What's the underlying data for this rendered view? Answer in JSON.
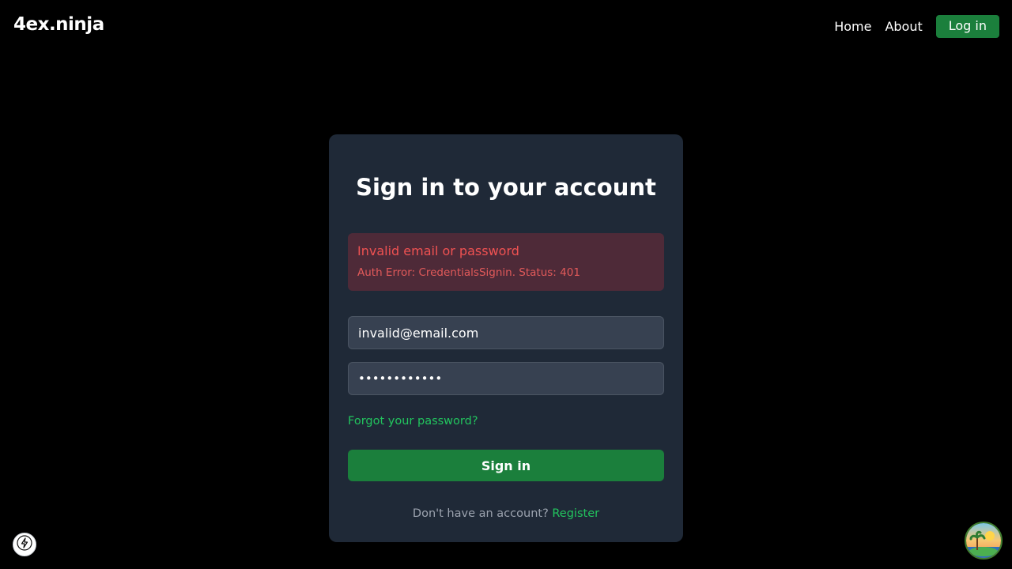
{
  "navbar": {
    "brand": "4ex.ninja",
    "links": [
      {
        "label": "Home"
      },
      {
        "label": "About"
      }
    ],
    "login_label": "Log in"
  },
  "signin": {
    "title": "Sign in to your account",
    "error": {
      "title": "Invalid email or password",
      "detail": "Auth Error: CredentialsSignin. Status: 401"
    },
    "email_value": "invalid@email.com",
    "password_value": "••••••••••••",
    "forgot_label": "Forgot your password?",
    "submit_label": "Sign in",
    "register_prompt": "Don't have an account?",
    "register_label": "Register"
  },
  "icons": {
    "dev_badge": "lightning-icon",
    "avatar": "beach-avatar"
  },
  "colors": {
    "background": "#000000",
    "card": "#1f2937",
    "accent": "#1b7f3c",
    "link": "#22c55e",
    "error_bg": "#4e2a38",
    "error_text": "#f05252"
  }
}
